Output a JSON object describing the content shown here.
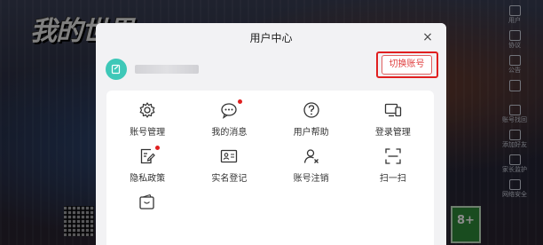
{
  "background": {
    "game_logo": "我的世界",
    "side_menu": [
      "用户",
      "协议",
      "公告",
      "",
      "账号找回",
      "",
      "添加好友",
      "",
      "",
      "家长监护",
      "",
      "网络安全"
    ],
    "age_rating": "8+"
  },
  "modal": {
    "title": "用户中心",
    "close_label": "×",
    "switch_account_label": "切换账号",
    "items": [
      {
        "label": "账号管理",
        "icon": "gear-icon",
        "badge": false
      },
      {
        "label": "我的消息",
        "icon": "message-icon",
        "badge": true
      },
      {
        "label": "用户帮助",
        "icon": "question-icon",
        "badge": false
      },
      {
        "label": "登录管理",
        "icon": "devices-icon",
        "badge": false
      },
      {
        "label": "隐私政策",
        "icon": "document-edit-icon",
        "badge": true
      },
      {
        "label": "实名登记",
        "icon": "id-card-icon",
        "badge": false
      },
      {
        "label": "账号注销",
        "icon": "user-remove-icon",
        "badge": false
      },
      {
        "label": "扫一扫",
        "icon": "scan-icon",
        "badge": false
      },
      {
        "label": "",
        "icon": "wallet-icon",
        "badge": false
      }
    ]
  },
  "colors": {
    "accent_red": "#e02020",
    "avatar_teal": "#3ec8b8"
  }
}
